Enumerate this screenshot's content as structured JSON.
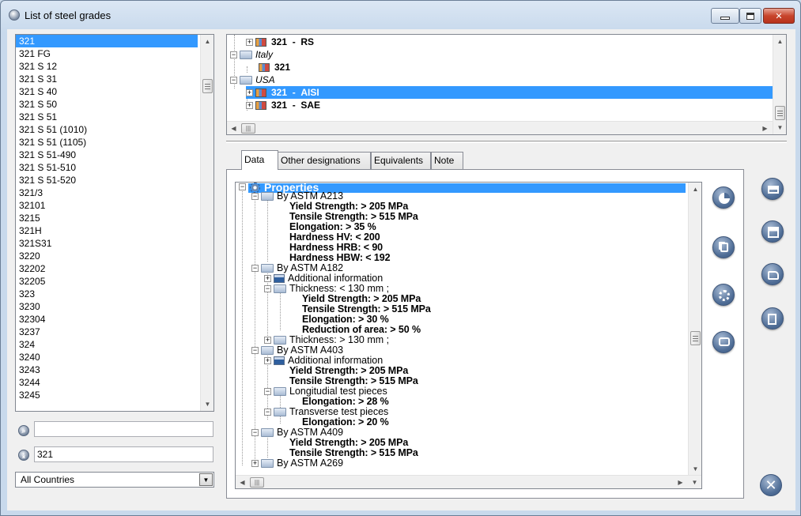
{
  "window": {
    "title": "List of steel grades"
  },
  "grades": [
    "321",
    "321 FG",
    "321 S 12",
    "321 S 31",
    "321 S 40",
    "321 S 50",
    "321 S 51",
    "321 S 51 (1010)",
    "321 S 51 (1105)",
    "321 S 51-490",
    "321 S 51-510",
    "321 S 51-520",
    "321/3",
    "32101",
    "3215",
    "321H",
    "321S31",
    "3220",
    "32202",
    "32205",
    "323",
    "3230",
    "32304",
    "3237",
    "324",
    "3240",
    "3243",
    "3244",
    "3245"
  ],
  "search": {
    "value": ""
  },
  "grade_input": {
    "value": "321"
  },
  "country_select": {
    "value": "All Countries"
  },
  "country_tree": {
    "rs_name": "321",
    "rs_std": "RS",
    "italy": "Italy",
    "italy_grade": "321",
    "usa": "USA",
    "aisi_name": "321",
    "aisi_std": "AISI",
    "sae_name": "321",
    "sae_std": "SAE",
    "sep": "-"
  },
  "tabs": [
    "Data",
    "Other designations",
    "Equivalents",
    "Note"
  ],
  "props": {
    "root": "Properties",
    "a213": "By ASTM A213",
    "a213_yield": "Yield Strength: > 205 MPa",
    "a213_tensile": "Tensile Strength: > 515 MPa",
    "a213_elong": "Elongation: > 35 %",
    "a213_hv": "Hardness HV: < 200",
    "a213_hrb": "Hardness HRB: < 90",
    "a213_hbw": "Hardness HBW: < 192",
    "a182": "By ASTM  A182",
    "addl": "Additional information",
    "thick1": "Thickness: < 130 mm ;",
    "a182_yield": "Yield Strength: > 205 MPa",
    "a182_tensile": "Tensile Strength: > 515 MPa",
    "a182_elong": "Elongation: > 30 %",
    "a182_red": "Reduction of area: > 50 %",
    "thick2": "Thickness: > 130 mm ;",
    "a403": "By ASTM A403",
    "addl2": "Additional information",
    "a403_yield": "Yield Strength: > 205 MPa",
    "a403_tensile": "Tensile Strength: > 515 MPa",
    "long": "Longitudial test pieces",
    "long_elong": "Elongation: > 28 %",
    "trans": "Transverse test pieces",
    "trans_elong": "Elongation: > 20 %",
    "a409": "By ASTM A409",
    "a409_yield": "Yield Strength: > 205 MPa",
    "a409_tensile": "Tensile Strength: > 515 MPa",
    "a269": "By ASTM A269"
  },
  "icons": {
    "panel_buttons": [
      "pie-chart-icon",
      "copy-icon",
      "gear-icon",
      "comment-icon"
    ],
    "side_buttons": [
      "print-icon",
      "save-icon",
      "open-icon",
      "export-icon"
    ],
    "accent": "#3399ff"
  }
}
